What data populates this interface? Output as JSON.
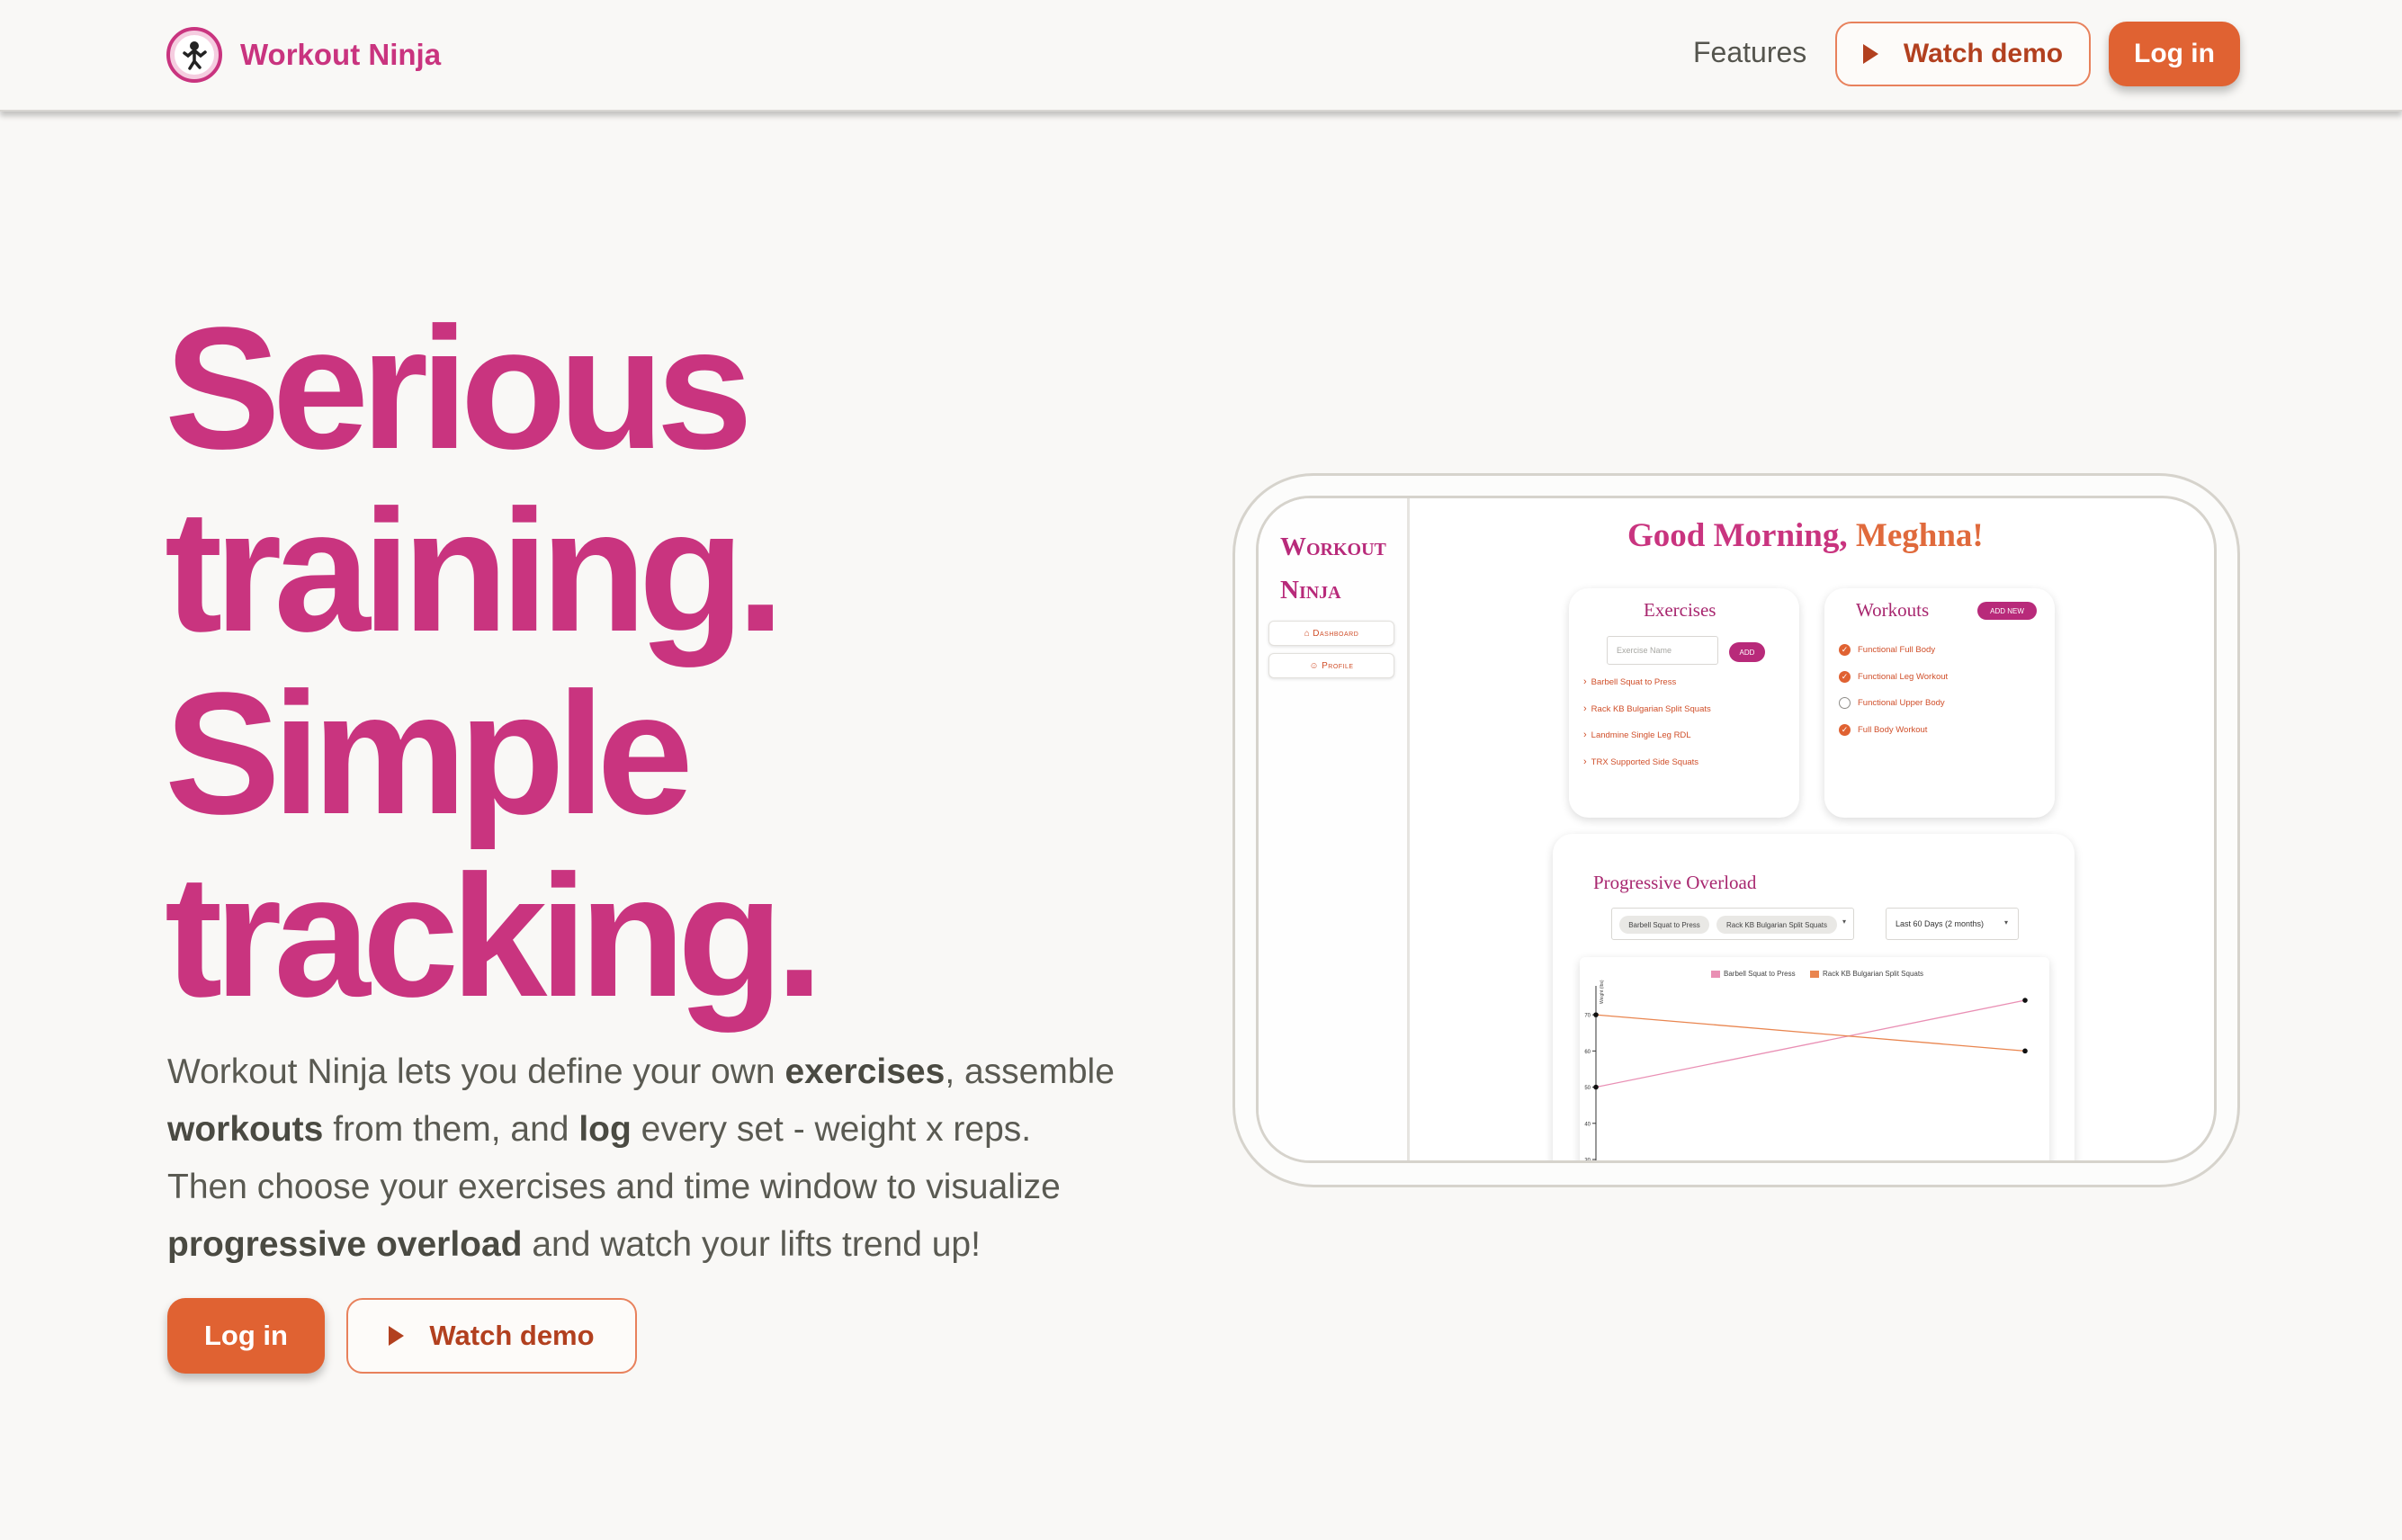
{
  "header": {
    "brand_name": "Workout Ninja",
    "nav_features": "Features",
    "watch_demo": "Watch demo",
    "log_in": "Log in"
  },
  "hero": {
    "title_lines": [
      "Serious",
      "training.",
      "Simple",
      "tracking."
    ],
    "copy": {
      "p1": "Workout Ninja lets you define your own ",
      "b1": "exercises",
      "p2": ", assemble",
      "b2": "workouts",
      "p3": " from them, and ",
      "b3": "log",
      "p4": " every set - weight x reps.",
      "p5": "Then choose your exercises and time window to visualize",
      "b4": "progressive overload",
      "p6": " and watch your lifts trend up!"
    },
    "log_in": "Log in",
    "watch_demo": "Watch demo"
  },
  "preview": {
    "brand_line1": "Workout",
    "brand_line2": "Ninja",
    "side_dashboard": "Dashboard",
    "side_profile": "Profile",
    "greeting": "Good Morning,",
    "greeting_name": "Meghna!",
    "exercises": {
      "title": "Exercises",
      "placeholder": "Exercise Name",
      "add": "ADD",
      "items": [
        "Barbell Squat to Press",
        "Rack KB Bulgarian Split Squats",
        "Landmine Single Leg RDL",
        "TRX Supported Side Squats"
      ]
    },
    "workouts": {
      "title": "Workouts",
      "add_new": "ADD NEW",
      "items": [
        {
          "name": "Functional Full Body",
          "done": true
        },
        {
          "name": "Functional Leg Workout",
          "done": true
        },
        {
          "name": "Functional Upper Body",
          "done": false
        },
        {
          "name": "Full Body Workout",
          "done": true
        }
      ]
    },
    "overload": {
      "title": "Progressive Overload",
      "chips": [
        "Barbell Squat to Press",
        "Rack KB Bulgarian Split Squats"
      ],
      "window": "Last 60 Days (2 months)",
      "y_label": "Weight (lbs)"
    }
  },
  "colors": {
    "brand_pink": "#c9347f",
    "brand_orange": "#e06232",
    "background": "#f9f8f6"
  },
  "chart_data": {
    "type": "line",
    "series": [
      {
        "name": "Barbell Squat to Press",
        "color": "#e98fb4",
        "values": [
          [
            0,
            50
          ],
          [
            1,
            74
          ]
        ]
      },
      {
        "name": "Rack KB Bulgarian Split Squats",
        "color": "#e9854f",
        "values": [
          [
            0,
            70
          ],
          [
            1,
            60
          ]
        ]
      }
    ],
    "y_ticks": [
      70,
      60,
      50,
      40,
      30
    ],
    "ylim": [
      30,
      76
    ]
  }
}
